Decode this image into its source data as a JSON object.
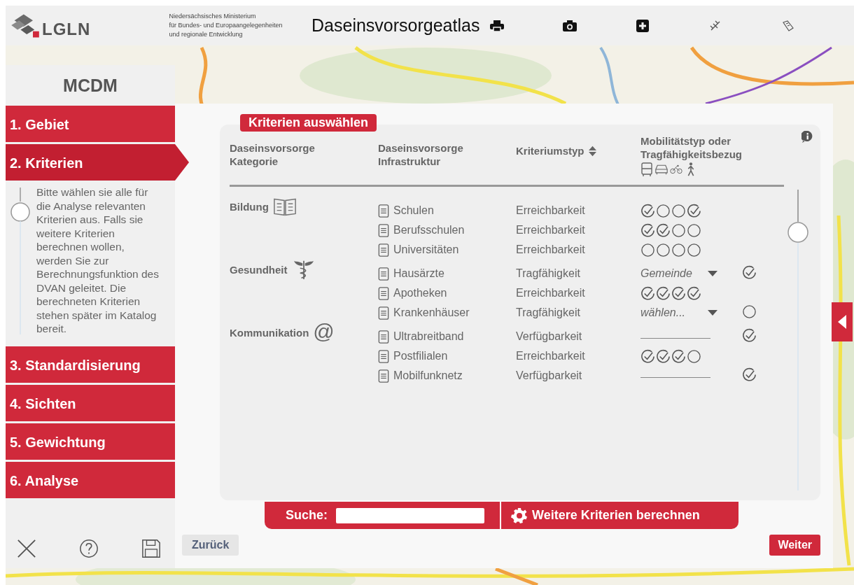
{
  "header": {
    "logo_text": "LGLN",
    "ministry": [
      "Niedersächsisches Ministerium",
      "für Bundes- und Europaangelegenheiten",
      "und regionale Entwicklung"
    ],
    "title": "Daseinsvorsorgeatlas"
  },
  "sidebar": {
    "title": "MCDM",
    "steps": [
      {
        "label": "1. Gebiet",
        "selected": false
      },
      {
        "label": "2. Kriterien",
        "selected": true
      },
      {
        "label": "3. Standardisierung",
        "selected": false
      },
      {
        "label": "4. Sichten",
        "selected": false
      },
      {
        "label": "5. Gewichtung",
        "selected": false
      },
      {
        "label": "6. Analyse",
        "selected": false
      }
    ],
    "description": "Bitte wählen sie alle für die Analyse relevanten Kriterien aus. Falls sie weitere Kriterien berechnen wollen, werden Sie zur Berechnungsfunktion des DVAN geleitet. Die berechneten Kriterien stehen später im Katalog bereit."
  },
  "panel": {
    "title": "Kriterien auswählen",
    "columns": [
      "Daseinsvorsorge Kategorie",
      "Daseinsvorsorge Infrastruktur",
      "Kriteriumstyp",
      "Mobilitätstyp oder Tragfähigkeitsbezug"
    ],
    "categories": [
      {
        "name": "Bildung",
        "items": [
          {
            "name": "Schulen",
            "type": "Erreichbarkeit",
            "kind": "modes",
            "modes": [
              true,
              false,
              false,
              true
            ]
          },
          {
            "name": "Berufsschulen",
            "type": "Erreichbarkeit",
            "kind": "modes",
            "modes": [
              true,
              true,
              false,
              false
            ]
          },
          {
            "name": "Universitäten",
            "type": "Erreichbarkeit",
            "kind": "modes",
            "modes": [
              false,
              false,
              false,
              false
            ]
          }
        ]
      },
      {
        "name": "Gesundheit",
        "items": [
          {
            "name": "Hausärzte",
            "type": "Tragfähigkeit",
            "kind": "dropdown",
            "value": "Gemeinde",
            "checked": true
          },
          {
            "name": "Apotheken",
            "type": "Erreichbarkeit",
            "kind": "modes",
            "modes": [
              true,
              true,
              true,
              true
            ]
          },
          {
            "name": "Krankenhäuser",
            "type": "Tragfähigkeit",
            "kind": "dropdown",
            "value": "wählen...",
            "checked": false
          }
        ]
      },
      {
        "name": "Kommunikation",
        "symbol": "@",
        "items": [
          {
            "name": "Ultrabreitband",
            "type": "Verfügbarkeit",
            "kind": "line",
            "checked": true
          },
          {
            "name": "Postfilialen",
            "type": "Erreichbarkeit",
            "kind": "modes",
            "modes": [
              true,
              true,
              true,
              false
            ]
          },
          {
            "name": "Mobilfunknetz",
            "type": "Verfügbarkeit",
            "kind": "line",
            "checked": true
          }
        ]
      }
    ],
    "search_label": "Suche:",
    "compute_button": "Weitere Kriterien berechnen"
  },
  "buttons": {
    "back": "Zurück",
    "next": "Weiter"
  }
}
